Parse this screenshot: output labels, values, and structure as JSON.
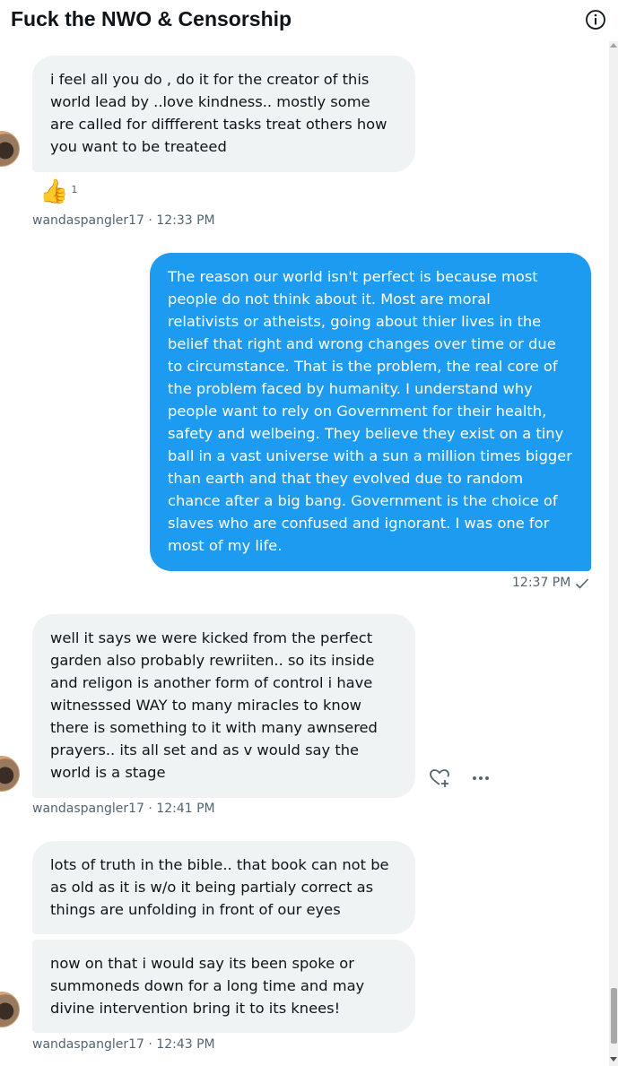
{
  "header": {
    "title": "Fuck the NWO & Censorship",
    "info_icon": "info-icon"
  },
  "messages": [
    {
      "direction": "incoming",
      "text": "i feel all you do , do it for the creator of this\nworld lead by ..love kindness.. mostly some\nare called for diffferent tasks treat others how\nyou want to be treateed",
      "reaction": {
        "emoji": "👍",
        "count": "1"
      },
      "meta": "wandaspangler17 · 12:33 PM"
    },
    {
      "direction": "outgoing",
      "text": "The reason our world isn't perfect is because most\npeople do not think about it. Most are moral\nrelativists or atheists, going about thier lives in the\nbelief that right and wrong changes over time or due\nto circumstance. That is the problem, the real core of\nthe problem faced by humanity. I understand why\npeople want to rely on Government for their health,\nsafety and welbeing. They believe they exist on a tiny\nball in a vast universe with a sun a million times bigger\nthan earth and that they evolved due to random\nchance after a big bang. Government is the choice of\nslaves who are confused and ignorant. I was one for\nmost of my life.",
      "meta": "12:37 PM",
      "status_icon": "check-icon"
    },
    {
      "direction": "incoming",
      "text": "well it says we were kicked from the perfect\ngarden also probably rewriiten.. so its inside\nand religon is another form of control i have\nwitnesssed WAY to many miracles to know\nthere is something to it with many awnsered\nprayers.. its all set and as v would say the\nworld is a stage",
      "meta": "wandaspangler17 · 12:41 PM",
      "actions": [
        "react-icon",
        "more-icon"
      ]
    },
    {
      "direction": "incoming",
      "text": "lots of truth in the bible.. that book can not be\nas old as it is w/o it being partialy correct as\nthings are unfolding in front of our eyes"
    },
    {
      "direction": "incoming",
      "text": "now on that i would say its been spoke or\nsummoneds down for a long time and may\ndivine intervention bring it to its knees!",
      "meta": "wandaspangler17 · 12:43 PM"
    }
  ],
  "colors": {
    "incoming_bubble": "#eff3f4",
    "outgoing_bubble": "#1d9bf0",
    "meta_text": "#536471",
    "title_text": "#0f1419"
  }
}
